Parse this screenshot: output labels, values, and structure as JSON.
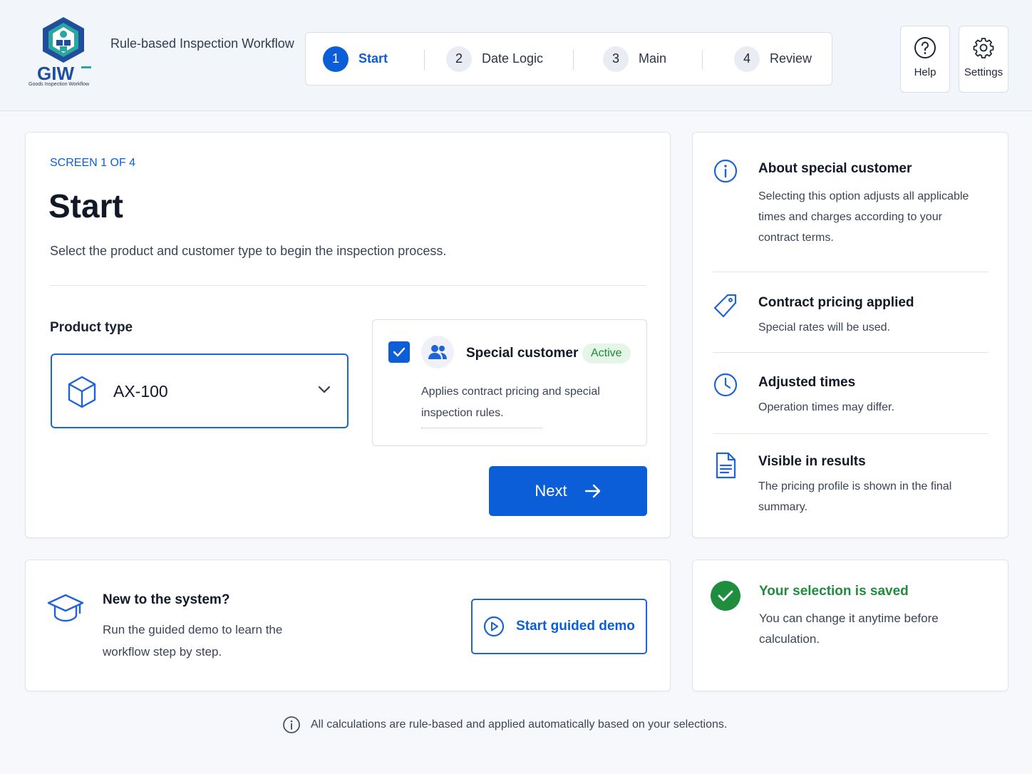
{
  "app": {
    "logo_text": "GIW",
    "logo_subtitle": "Goods Inspection Workflow",
    "title": "Rule-based Inspection Workflow"
  },
  "stepper": {
    "steps": [
      {
        "number": "1",
        "label": "Start",
        "active": true
      },
      {
        "number": "2",
        "label": "Date Logic",
        "active": false
      },
      {
        "number": "3",
        "label": "Main",
        "active": false
      },
      {
        "number": "4",
        "label": "Review",
        "active": false
      }
    ]
  },
  "header_buttons": {
    "help_label": "Help",
    "settings_label": "Settings"
  },
  "main": {
    "screen_label": "SCREEN 1 OF 4",
    "title": "Start",
    "description": "Select the product and customer type to begin the inspection process.",
    "product_type_label": "Product type",
    "product_type_value": "AX-100",
    "special_customer": {
      "checked": true,
      "title": "Special customer",
      "badge": "Active",
      "description": "Applies contract pricing and special inspection rules."
    },
    "next_label": "Next"
  },
  "info_panel": {
    "items": [
      {
        "icon": "info-icon",
        "title": "About special customer",
        "description": "Selecting this option adjusts all applicable times and charges according to your contract terms."
      },
      {
        "icon": "tag-icon",
        "title": "Contract pricing applied",
        "description": "Special rates will be used."
      },
      {
        "icon": "clock-icon",
        "title": "Adjusted times",
        "description": "Operation times may differ."
      },
      {
        "icon": "document-icon",
        "title": "Visible in results",
        "description": "The pricing profile is shown in the final summary."
      }
    ]
  },
  "demo": {
    "title": "New to the system?",
    "description": "Run the guided demo to learn the workflow step by step.",
    "button_label": "Start guided demo"
  },
  "saved": {
    "title": "Your selection is saved",
    "description": "You can change it anytime before calculation."
  },
  "footer": {
    "text": "All calculations are rule-based and applied automatically based on your selections."
  },
  "colors": {
    "primary": "#0b5ed7",
    "success": "#1e8e3e",
    "badge_bg": "#e5f5e8"
  }
}
